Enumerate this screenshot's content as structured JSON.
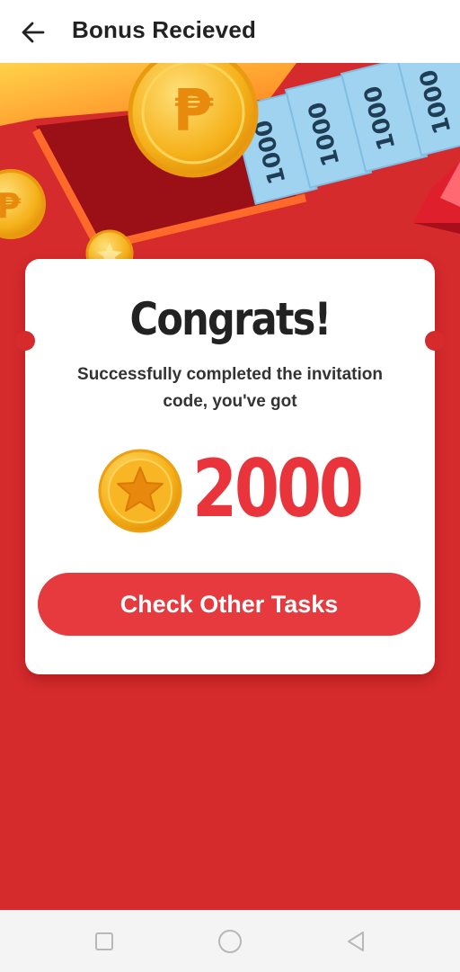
{
  "header": {
    "title": "Bonus Recieved",
    "back_icon": "arrow-left-icon"
  },
  "hero": {
    "banknote_labels": [
      "1000",
      "1000",
      "1000",
      "1000"
    ],
    "currency_symbol": "₱",
    "colors": {
      "background": "#d52b2d",
      "gold": "#f6b51e",
      "banknote": "#9fd3f0"
    }
  },
  "card": {
    "heading": "Congrats!",
    "message": "Successfully completed the invitation code, you've got",
    "reward_amount": "2000",
    "reward_icon": "star-coin-icon",
    "cta_label": "Check Other Tasks",
    "colors": {
      "accent": "#e63a3e",
      "amount": "#e8343a"
    }
  },
  "navbar": {
    "icons": [
      "square-recent-apps-icon",
      "circle-home-icon",
      "triangle-back-icon"
    ]
  }
}
